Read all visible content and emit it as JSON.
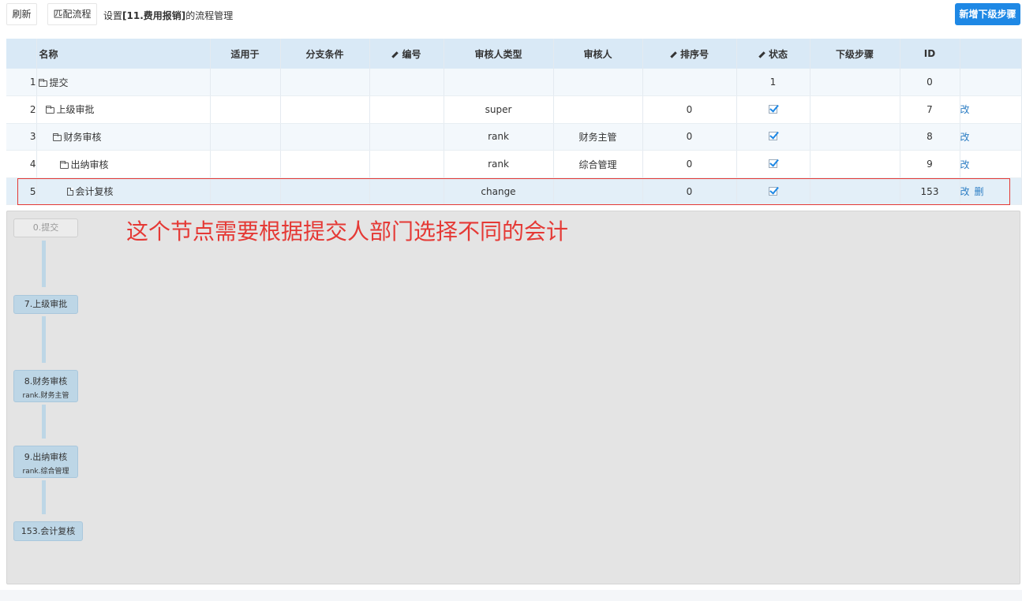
{
  "toolbar": {
    "refresh_label": "刷新",
    "match_label": "匹配流程",
    "title_prefix": "设置",
    "title_bold": "[11.费用报销]",
    "title_suffix": "的流程管理",
    "add_step_label": "新增下级步骤"
  },
  "table": {
    "headers": {
      "name": "名称",
      "applies_to": "适用于",
      "branch_condition": "分支条件",
      "number": "编号",
      "reviewer_type": "审核人类型",
      "reviewer": "审核人",
      "sort_no": "排序号",
      "status": "状态",
      "next_step": "下级步骤",
      "id": "ID"
    },
    "rows": [
      {
        "index": "1",
        "name": "提交",
        "reviewer_type": "",
        "reviewer": "",
        "sort_no": "",
        "status": "1",
        "id": "0",
        "edit": "",
        "delete": ""
      },
      {
        "index": "2",
        "name": "上级审批",
        "reviewer_type": "super",
        "reviewer": "",
        "sort_no": "0",
        "status": "checked",
        "id": "7",
        "edit": "改",
        "delete": ""
      },
      {
        "index": "3",
        "name": "财务审核",
        "reviewer_type": "rank",
        "reviewer": "财务主管",
        "sort_no": "0",
        "status": "checked",
        "id": "8",
        "edit": "改",
        "delete": ""
      },
      {
        "index": "4",
        "name": "出纳审核",
        "reviewer_type": "rank",
        "reviewer": "综合管理",
        "sort_no": "0",
        "status": "checked",
        "id": "9",
        "edit": "改",
        "delete": ""
      },
      {
        "index": "5",
        "name": "会计复核",
        "reviewer_type": "change",
        "reviewer": "",
        "sort_no": "0",
        "status": "checked",
        "id": "153",
        "edit": "改",
        "delete": "删"
      }
    ]
  },
  "annotation": "这个节点需要根据提交人部门选择不同的会计",
  "flow": {
    "nodes": [
      {
        "line1": "0.提交",
        "line2": ""
      },
      {
        "line1": "7.上级审批",
        "line2": ""
      },
      {
        "line1": "8.财务审核",
        "line2": "rank.财务主管"
      },
      {
        "line1": "9.出纳审核",
        "line2": "rank.综合管理"
      },
      {
        "line1": "153.会计复核",
        "line2": ""
      }
    ]
  },
  "colors": {
    "accent": "#1e88e5",
    "annotation": "#e53935",
    "node_bg": "#bdd6e6",
    "header_bg": "#d9e9f6"
  }
}
